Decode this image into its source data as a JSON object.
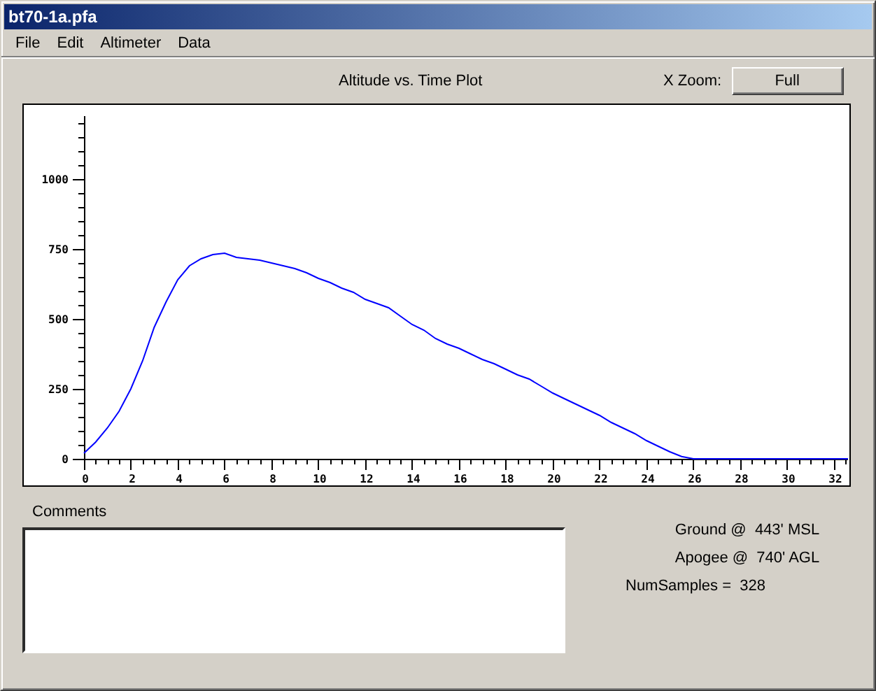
{
  "window": {
    "title": "bt70-1a.pfa"
  },
  "menu": [
    "File",
    "Edit",
    "Altimeter",
    "Data"
  ],
  "plot": {
    "zoom_label": "X Zoom:",
    "zoom_button": "Full",
    "chart_data": {
      "type": "line",
      "title": "Altitude vs. Time Plot",
      "xlim": [
        0,
        32.6
      ],
      "ylim": [
        0,
        1225
      ],
      "xticks": [
        0,
        2,
        4,
        6,
        8,
        10,
        12,
        14,
        16,
        18,
        20,
        22,
        24,
        26,
        28,
        30,
        32
      ],
      "yticks": [
        0,
        250,
        500,
        750,
        1000
      ],
      "x": [
        0,
        0.5,
        1,
        1.5,
        2,
        2.5,
        3,
        3.5,
        4,
        4.5,
        5,
        5.5,
        6,
        6.5,
        7,
        7.5,
        8,
        8.5,
        9,
        9.5,
        10,
        10.5,
        11,
        11.5,
        12,
        12.5,
        13,
        13.5,
        14,
        14.5,
        15,
        15.5,
        16,
        16.5,
        17,
        17.5,
        18,
        18.5,
        19,
        19.5,
        20,
        20.5,
        21,
        21.5,
        22,
        22.5,
        23,
        23.5,
        24,
        24.5,
        25,
        25.5,
        26,
        27,
        28,
        29,
        30,
        31,
        32,
        32.6
      ],
      "series": [
        {
          "color": "#0000ff",
          "values": [
            20,
            60,
            110,
            170,
            250,
            350,
            470,
            560,
            640,
            690,
            715,
            730,
            735,
            720,
            715,
            710,
            700,
            690,
            680,
            665,
            645,
            630,
            610,
            595,
            570,
            555,
            540,
            510,
            480,
            460,
            430,
            410,
            395,
            375,
            355,
            340,
            320,
            300,
            285,
            260,
            235,
            215,
            195,
            175,
            155,
            130,
            110,
            90,
            65,
            45,
            25,
            8,
            0,
            0,
            0,
            0,
            0,
            0,
            0,
            0
          ]
        }
      ]
    }
  },
  "comments": {
    "label": "Comments"
  },
  "stats": [
    "Ground @  443' MSL",
    "Apogee @  740' AGL",
    "NumSamples =  328"
  ]
}
